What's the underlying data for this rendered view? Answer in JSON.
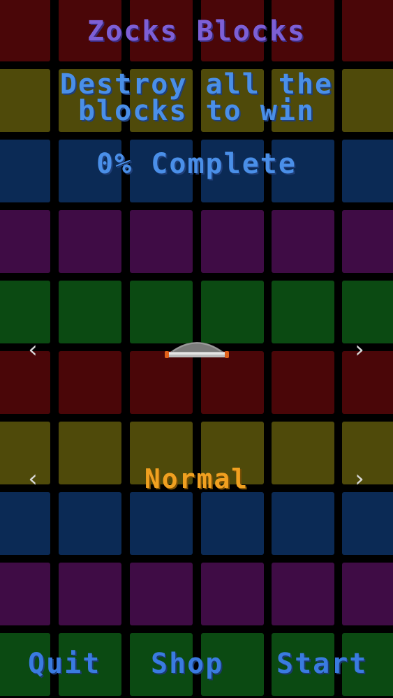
{
  "game": {
    "title": "Zocks Blocks",
    "instructions": "Destroy all the\nblocks to win",
    "progress": "0% Complete",
    "difficulty": "Normal"
  },
  "menu": {
    "quit": "Quit",
    "shop": "Shop",
    "start": "Start"
  },
  "board": {
    "row_colors": [
      "#4a0608",
      "#4f4a0a",
      "#0b2a55",
      "#3f0c45",
      "#0b4a12",
      "#4a0608",
      "#4f4a0a",
      "#0b2a55",
      "#3f0c45",
      "#0b4a12"
    ],
    "columns": 6
  },
  "icons": {
    "paddle_selector_left": "chevron-left-icon",
    "paddle_selector_right": "chevron-right-icon",
    "difficulty_left": "chevron-left-icon",
    "difficulty_right": "chevron-right-icon",
    "paddle": "paddle-icon"
  }
}
